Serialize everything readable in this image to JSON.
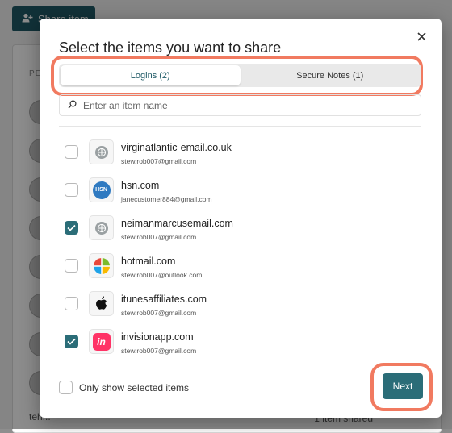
{
  "background": {
    "share_button_label": "Share item",
    "people_heading": "PEOPLE",
    "footer_email": "teh...",
    "footer_status": "1 item shared"
  },
  "modal": {
    "title": "Select the items you want to share",
    "tabs": [
      {
        "label": "Logins (2)",
        "active": true
      },
      {
        "label": "Secure Notes (1)",
        "active": false
      }
    ],
    "search": {
      "value": "",
      "placeholder": "Enter an item name"
    },
    "items": [
      {
        "name": "virginatlantic-email.co.uk",
        "email": "stew.rob007@gmail.com",
        "checked": false,
        "icon": "globe-icon"
      },
      {
        "name": "hsn.com",
        "email": "janecustomer884@gmail.com",
        "checked": false,
        "icon": "hsn-logo-icon"
      },
      {
        "name": "neimanmarcusemail.com",
        "email": "stew.rob007@gmail.com",
        "checked": true,
        "icon": "globe-icon"
      },
      {
        "name": "hotmail.com",
        "email": "stew.rob007@outlook.com",
        "checked": false,
        "icon": "microsoft-logo-icon"
      },
      {
        "name": "itunesaffiliates.com",
        "email": "stew.rob007@gmail.com",
        "checked": false,
        "icon": "apple-logo-icon"
      },
      {
        "name": "invisionapp.com",
        "email": "stew.rob007@gmail.com",
        "checked": true,
        "icon": "invision-logo-icon"
      }
    ],
    "hsn_logo_text": "HSN",
    "invision_logo_text": "in",
    "only_selected_label": "Only show selected items",
    "next_label": "Next"
  },
  "colors": {
    "accent": "#2b6d78",
    "highlight": "#f17a60"
  }
}
